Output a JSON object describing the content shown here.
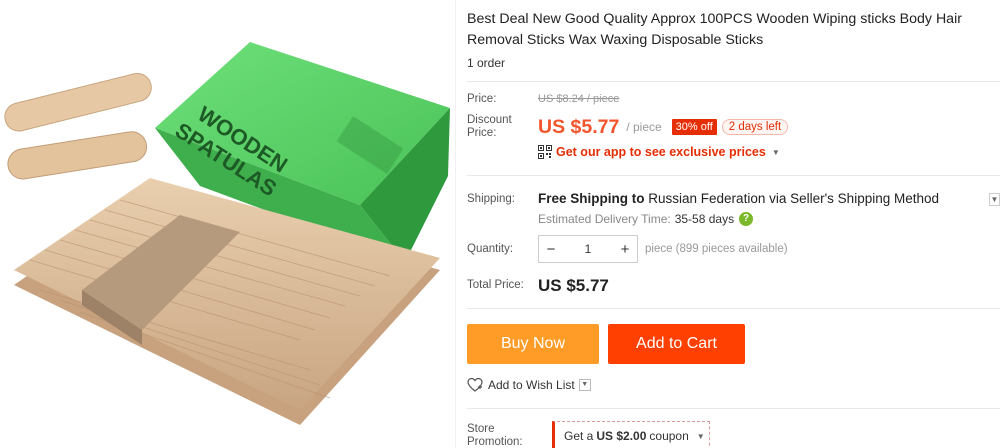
{
  "product": {
    "title": "Best Deal New Good Quality Approx 100PCS Wooden Wiping sticks Body Hair Removal Sticks Wax Waxing Disposable Sticks",
    "orders": "1 order",
    "image": {
      "box_text_line1": "WOODEN",
      "box_text_line2": "SPATULAS",
      "box_color": "#5fd36a"
    }
  },
  "pricing": {
    "price_label": "Price:",
    "original_price": "US $8.24 / piece",
    "discount_label_line1": "Discount",
    "discount_label_line2": "Price:",
    "discount_price": "US $5.77",
    "per_unit": "/ piece",
    "discount_badge": "30% off",
    "time_left_badge": "2 days left",
    "app_promo": "Get our app to see exclusive prices"
  },
  "shipping": {
    "label": "Shipping:",
    "free_text": "Free Shipping to",
    "destination": "Russian Federation via Seller's Shipping Method",
    "delivery_label": "Estimated Delivery Time:",
    "delivery_days": "35-58 days"
  },
  "quantity": {
    "label": "Quantity:",
    "value": "1",
    "decrement": "−",
    "increment": "+",
    "availability": "piece (899 pieces available)"
  },
  "total": {
    "label": "Total Price:",
    "value": "US $5.77"
  },
  "actions": {
    "buy_now": "Buy Now",
    "add_to_cart": "Add to Cart",
    "wishlist": "Add to Wish List"
  },
  "store": {
    "promotion_label_line1": "Store",
    "promotion_label_line2": "Promotion:",
    "coupon_prefix": "Get a",
    "coupon_amount": "US $2.00",
    "coupon_suffix": "coupon"
  },
  "colors": {
    "accent_red": "#e62e04",
    "price_orange": "#f2552c",
    "buy_now": "#ff9c28",
    "add_to_cart": "#ff4000",
    "help_green": "#7bb82a"
  },
  "icons": [
    "qr-code-icon",
    "chevron-down-icon",
    "question-icon",
    "heart-icon"
  ]
}
